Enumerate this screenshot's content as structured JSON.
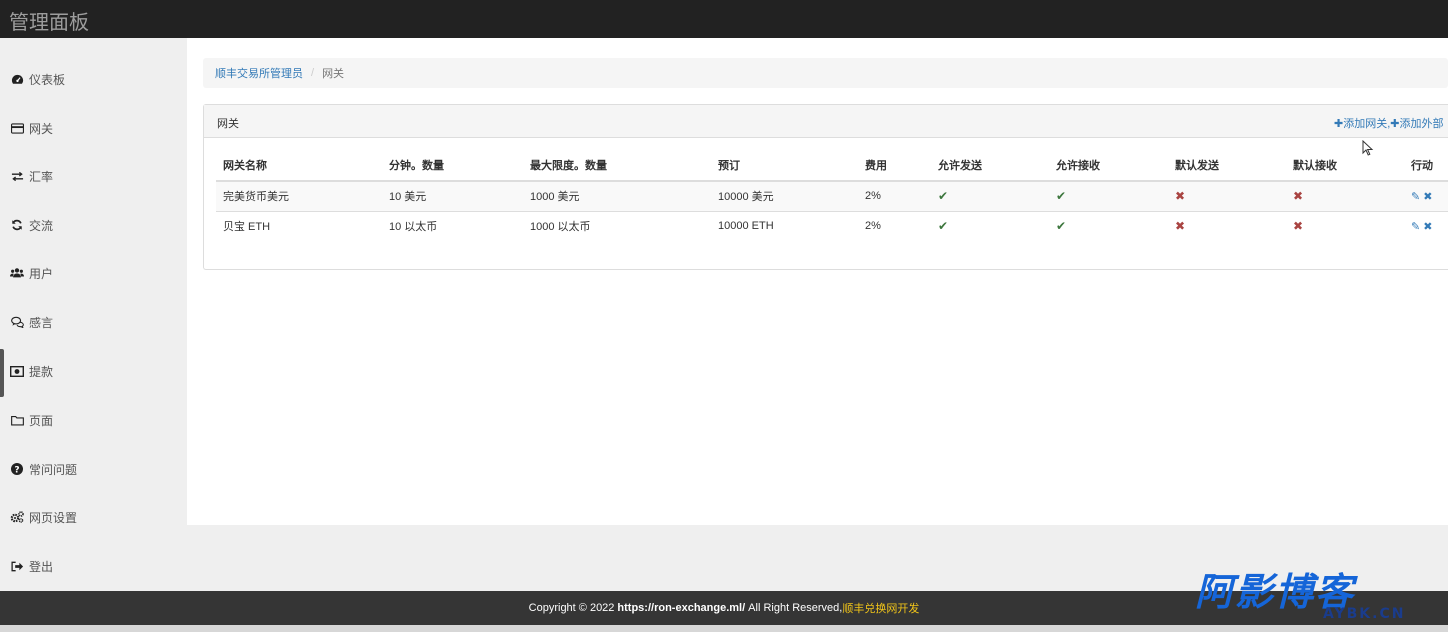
{
  "app": {
    "title": "管理面板"
  },
  "sidebar": {
    "items": [
      {
        "label": "仪表板",
        "icon": "dashboard-icon"
      },
      {
        "label": "网关",
        "icon": "credit-card-icon"
      },
      {
        "label": "汇率",
        "icon": "exchange-arrows-icon"
      },
      {
        "label": "交流",
        "icon": "refresh-icon"
      },
      {
        "label": "用户",
        "icon": "users-icon"
      },
      {
        "label": "感言",
        "icon": "comments-icon"
      },
      {
        "label": "提款",
        "icon": "money-icon"
      },
      {
        "label": "页面",
        "icon": "folder-icon"
      },
      {
        "label": "常问问题",
        "icon": "question-circle-icon"
      },
      {
        "label": "网页设置",
        "icon": "gears-icon"
      },
      {
        "label": "登出",
        "icon": "sign-out-icon"
      }
    ]
  },
  "breadcrumb": {
    "parent": "顺丰交易所管理员",
    "separator": "/",
    "current": "网关"
  },
  "panel": {
    "title": "网关",
    "add_gateway": "添加网关,",
    "add_external": "添加外部"
  },
  "table": {
    "headers": [
      "网关名称",
      "分钟。数量",
      "最大限度。数量",
      "预订",
      "费用",
      "允许发送",
      "允许接收",
      "默认发送",
      "默认接收",
      "行动"
    ],
    "rows": [
      {
        "name": "完美货币美元",
        "min": "10 美元",
        "max": "1000 美元",
        "reserve": "10000 美元",
        "fee": "2%",
        "allow_send": true,
        "allow_receive": true,
        "default_send": false,
        "default_receive": false
      },
      {
        "name": "贝宝 ETH",
        "min": "10 以太币",
        "max": "1000 以太币",
        "reserve": "10000 ETH",
        "fee": "2%",
        "allow_send": true,
        "allow_receive": true,
        "default_send": false,
        "default_receive": false
      }
    ]
  },
  "footer": {
    "copyright": "Copyright © 2022",
    "url": "https://ron-exchange.ml/",
    "rights": "All Right Reserved,",
    "developer": "顺丰兑换网开发"
  },
  "watermark": {
    "main": "阿影博客",
    "sub": "AYBK.CN"
  },
  "colors": {
    "accent": "#337ab7",
    "check": "#3c763d",
    "cross": "#a94442",
    "topbar": "#222222",
    "footer": "#353535",
    "developer": "#f0c419"
  }
}
